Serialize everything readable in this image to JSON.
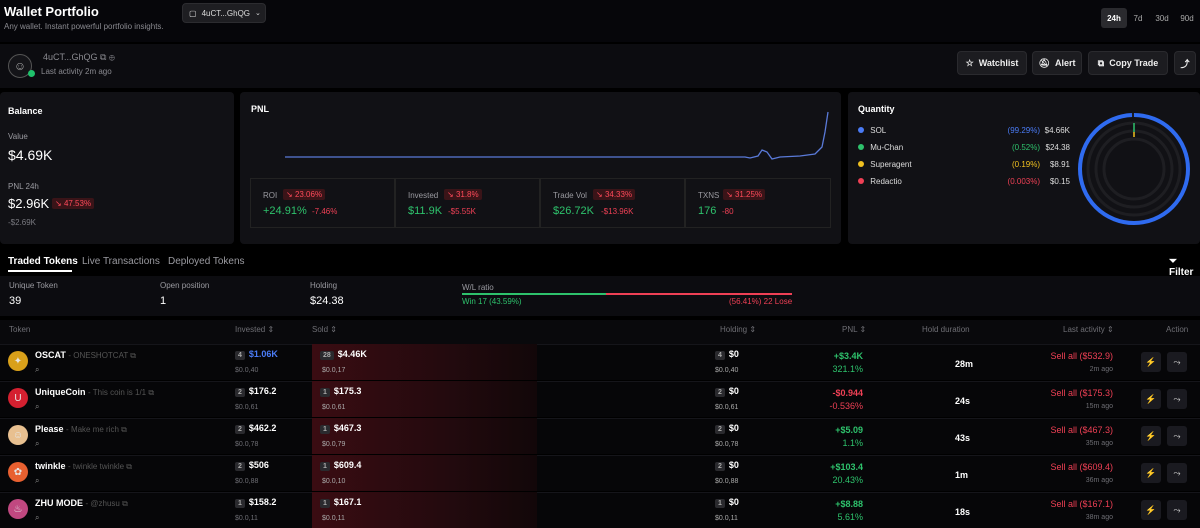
{
  "header": {
    "title": "Wallet Portfolio",
    "subtitle": "Any wallet. Instant powerful portfolio insights.",
    "wallet_chip": "4uCT...GhQG",
    "ranges": [
      "24h",
      "7d",
      "30d",
      "90d"
    ],
    "active_range": "24h"
  },
  "profile": {
    "name": "4uCT...GhQG",
    "last_activity": "Last activity 2m ago",
    "buttons": {
      "watchlist": "Watchlist",
      "alert": "Alert",
      "copy_trade": "Copy Trade"
    }
  },
  "balance": {
    "title": "Balance",
    "value_label": "Value",
    "value": "$4.69K",
    "pnl_label": "PNL 24h",
    "pnl": "$2.96K",
    "pnl_change": "47.53%",
    "pnl_sub": "-$2.69K"
  },
  "pnl_panel": {
    "title": "PNL",
    "stats": [
      {
        "label": "ROI",
        "badge": "23.06%",
        "value": "+24.91%",
        "change": "-7.46%"
      },
      {
        "label": "Invested",
        "badge": "31.8%",
        "value": "$11.9K",
        "change": "-$5.55K"
      },
      {
        "label": "Trade Vol",
        "badge": "34.33%",
        "value": "$26.72K",
        "change": "-$13.96K"
      },
      {
        "label": "TXNS",
        "badge": "31.25%",
        "value": "176",
        "change": "-80"
      }
    ]
  },
  "quantity": {
    "title": "Quantity",
    "items": [
      {
        "name": "SOL",
        "pct": "(99.29%)",
        "value": "$4.66K",
        "color": "#4a7bf5"
      },
      {
        "name": "Mu-Chan",
        "pct": "(0.52%)",
        "value": "$24.38",
        "color": "#2ec26c"
      },
      {
        "name": "Superagent",
        "pct": "(0.19%)",
        "value": "$8.91",
        "color": "#f0c020"
      },
      {
        "name": "Redactio",
        "pct": "(0.003%)",
        "value": "$0.15",
        "color": "#ef4055"
      }
    ]
  },
  "tabs": {
    "traded": "Traded Tokens",
    "live": "Live Transactions",
    "deployed": "Deployed Tokens",
    "filter": "Filter"
  },
  "summary": {
    "unique_label": "Unique Token",
    "unique": "39",
    "open_label": "Open position",
    "open": "1",
    "holding_label": "Holding",
    "holding": "$24.38",
    "wl_label": "W/L ratio",
    "win": "Win 17 (43.59%)",
    "lose": "(56.41%) 22 Lose",
    "win_fraction": 0.4359
  },
  "columns": {
    "token": "Token",
    "invested": "Invested",
    "sold": "Sold",
    "holding": "Holding",
    "pnl": "PNL",
    "hold": "Hold duration",
    "last": "Last activity",
    "action": "Action"
  },
  "rows": [
    {
      "name": "OSCAT",
      "sub": "ONESHOTCAT",
      "inv_cnt": "4",
      "inv": "$1.06K",
      "inv_sub": "$0.0,40",
      "sold_cnt": "28",
      "sold": "$4.46K",
      "sold_sub": "$0.0,17",
      "hold_cnt": "4",
      "hold": "$0",
      "hold_sub": "$0.0,40",
      "pnl": "+$3.4K",
      "pnl_pct": "321.1%",
      "pnl_pos": true,
      "duration": "28m",
      "last": "Sell all ($532.9)",
      "last_ago": "2m ago",
      "icon_bg": "#d9a01a",
      "icon": "✦"
    },
    {
      "name": "UniqueCoin",
      "sub": "This coin is 1/1",
      "inv_cnt": "2",
      "inv": "$176.2",
      "inv_sub": "$0.0,61",
      "sold_cnt": "1",
      "sold": "$175.3",
      "sold_sub": "$0.0,61",
      "hold_cnt": "2",
      "hold": "$0",
      "hold_sub": "$0.0,61",
      "pnl": "-$0.944",
      "pnl_pct": "-0.536%",
      "pnl_pos": false,
      "duration": "24s",
      "last": "Sell all ($175.3)",
      "last_ago": "15m ago",
      "icon_bg": "#d42030",
      "icon": "U"
    },
    {
      "name": "Please",
      "sub": "Make me rich",
      "inv_cnt": "2",
      "inv": "$462.2",
      "inv_sub": "$0.0,78",
      "sold_cnt": "1",
      "sold": "$467.3",
      "sold_sub": "$0.0,79",
      "hold_cnt": "2",
      "hold": "$0",
      "hold_sub": "$0.0,78",
      "pnl": "+$5.09",
      "pnl_pct": "1.1%",
      "pnl_pos": true,
      "duration": "43s",
      "last": "Sell all ($467.3)",
      "last_ago": "35m ago",
      "icon_bg": "#e8c090",
      "icon": "☺"
    },
    {
      "name": "twinkle",
      "sub": "twinkle twinkle",
      "inv_cnt": "2",
      "inv": "$506",
      "inv_sub": "$0.0,88",
      "sold_cnt": "1",
      "sold": "$609.4",
      "sold_sub": "$0.0,10",
      "hold_cnt": "2",
      "hold": "$0",
      "hold_sub": "$0.0,88",
      "pnl": "+$103.4",
      "pnl_pct": "20.43%",
      "pnl_pos": true,
      "duration": "1m",
      "last": "Sell all ($609.4)",
      "last_ago": "36m ago",
      "icon_bg": "#e86030",
      "icon": "✿"
    },
    {
      "name": "ZHU MODE",
      "sub": "@zhusu",
      "inv_cnt": "1",
      "inv": "$158.2",
      "inv_sub": "$0.0,11",
      "sold_cnt": "1",
      "sold": "$167.1",
      "sold_sub": "$0.0,11",
      "hold_cnt": "1",
      "hold": "$0",
      "hold_sub": "$0.0,11",
      "pnl": "+$8.88",
      "pnl_pct": "5.61%",
      "pnl_pos": true,
      "duration": "18s",
      "last": "Sell all ($167.1)",
      "last_ago": "38m ago",
      "icon_bg": "#c04880",
      "icon": "♨"
    }
  ]
}
